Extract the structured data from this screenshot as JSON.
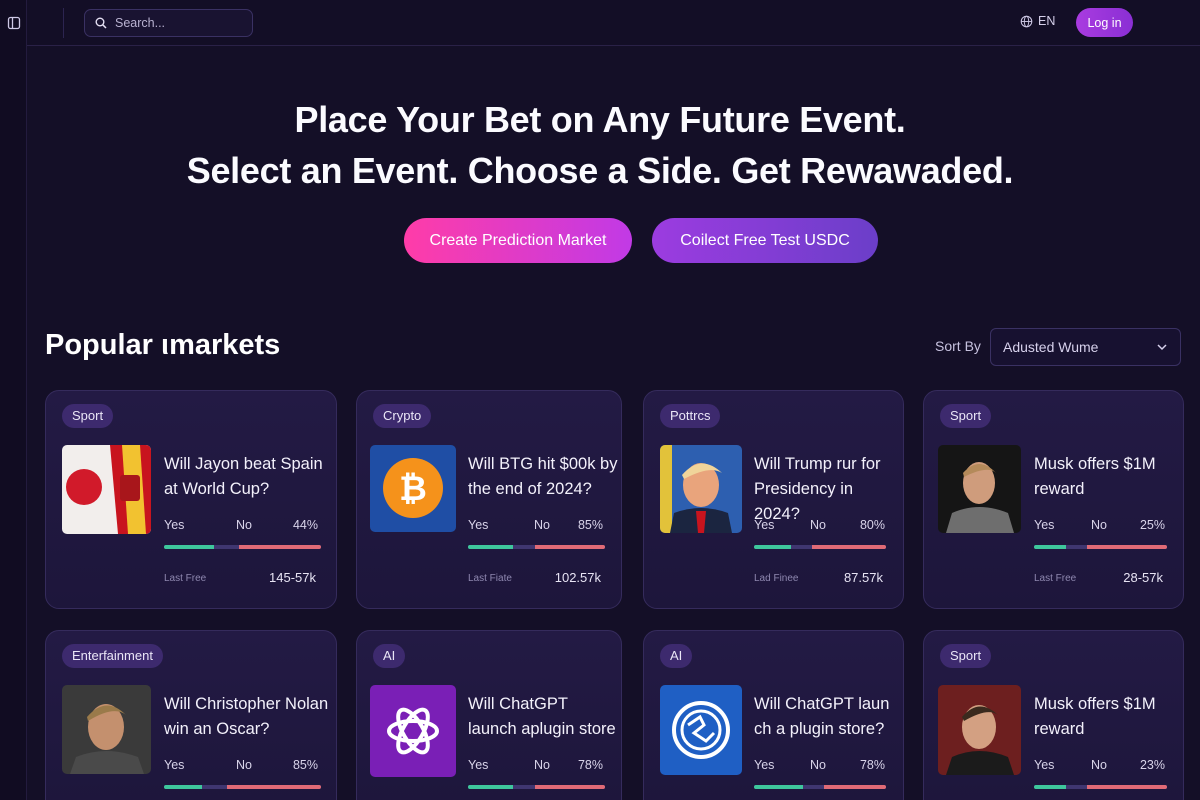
{
  "header": {
    "search_placeholder": "Search...",
    "language": "EN",
    "login_label": "Log in"
  },
  "hero": {
    "line1": "Place Your Bet on Any Future Event.",
    "line2": "Select an Event. Choose a Side. Get Rewawaded.",
    "create_label": "Create Prediction Market",
    "collect_label": "Coilect Free Test USDC"
  },
  "markets": {
    "title": "Popular ιmarkets",
    "sort_label": "Sort By",
    "sort_value": "Adusted Wume",
    "cards": [
      {
        "tag": "Sport",
        "question": "Will Jayon beat Spain at World Cup?",
        "yes": "Yes",
        "no": "No",
        "percent": "44%",
        "yes_share": 0.32,
        "last_label": "Last Free",
        "last_value": "145-57k",
        "thumb": "flags-japan-spain"
      },
      {
        "tag": "Crypto",
        "question": "Will BTG hit $00k by the end of 2024?",
        "yes": "Yes",
        "no": "No",
        "percent": "85%",
        "yes_share": 0.33,
        "last_label": "Last Fiate",
        "last_value": "102.57k",
        "thumb": "bitcoin-logo"
      },
      {
        "tag": "Pottrcs",
        "question": "Will Trump rur for Presidency in 2024?",
        "yes": "Yes",
        "no": "No",
        "percent": "80%",
        "yes_share": 0.28,
        "last_label": "Lad Finee",
        "last_value": "87.57k",
        "thumb": "portrait-politician"
      },
      {
        "tag": "Sport",
        "question": "Musk offers $1M reward",
        "yes": "Yes",
        "no": "No",
        "percent": "25%",
        "yes_share": 0.24,
        "last_label": "Last Free",
        "last_value": "28-57k",
        "thumb": "portrait-man"
      },
      {
        "tag": "Enterfainment",
        "question": "Will Christopher Nolan win an Oscar?",
        "yes": "Yes",
        "no": "No",
        "percent": "85%",
        "yes_share": 0.24,
        "last_label": "",
        "last_value": "",
        "thumb": "portrait-director"
      },
      {
        "tag": "AI",
        "question": "Will ChatGPT launch aplugin store",
        "yes": "Yes",
        "no": "No",
        "percent": "78%",
        "yes_share": 0.33,
        "last_label": "",
        "last_value": "",
        "thumb": "openai-logo"
      },
      {
        "tag": "AI",
        "question": "Will ChatGPT laun ch a plugin store?",
        "yes": "Yes",
        "no": "No",
        "percent": "78%",
        "yes_share": 0.37,
        "last_label": "",
        "last_value": "",
        "thumb": "globe-logo"
      },
      {
        "tag": "Sport",
        "question": "Musk offers $1M reward",
        "yes": "Yes",
        "no": "No",
        "percent": "23%",
        "yes_share": 0.24,
        "last_label": "",
        "last_value": "",
        "thumb": "portrait-man-2"
      }
    ]
  },
  "colors": {
    "background": "#140f27",
    "yes_bar": "#3ec79c",
    "no_bar": "#e06a76",
    "accent_pink": "#ff3ca8",
    "accent_purple": "#8a2fd4"
  }
}
